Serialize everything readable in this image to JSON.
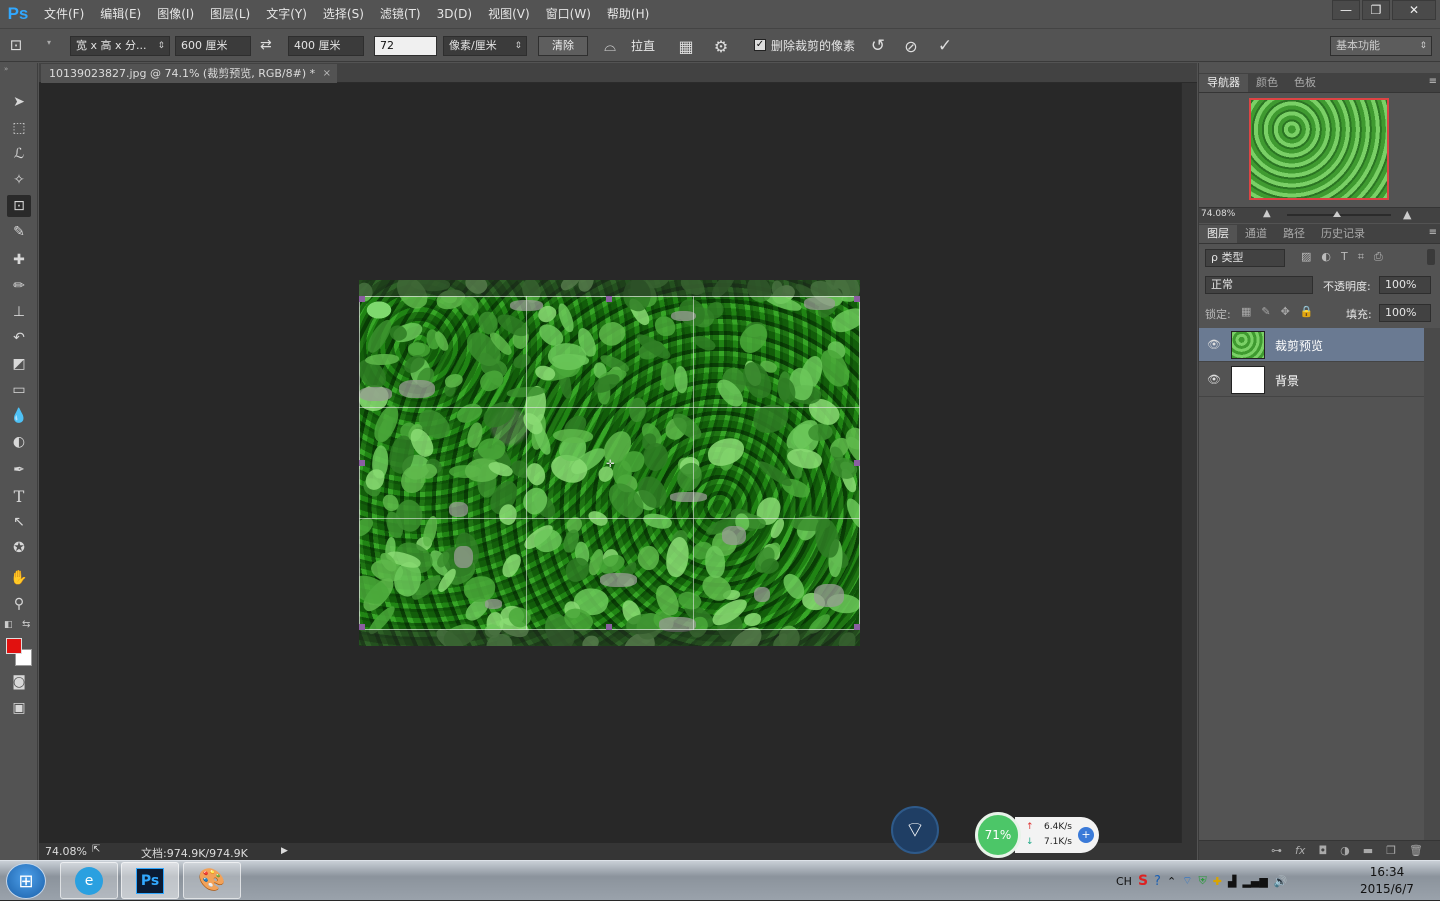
{
  "app": {
    "logo": "Ps",
    "accent": "#31a8ff"
  },
  "menu": [
    "文件(F)",
    "编辑(E)",
    "图像(I)",
    "图层(L)",
    "文字(Y)",
    "选择(S)",
    "滤镜(T)",
    "3D(D)",
    "视图(V)",
    "窗口(W)",
    "帮助(H)"
  ],
  "window_controls": {
    "minimize": "—",
    "restore": "❐",
    "close": "✕"
  },
  "options": {
    "ratio_preset": "宽 x 高 x 分...",
    "width": "600 厘米",
    "height": "400 厘米",
    "resolution": "72",
    "unit": "像素/厘米",
    "clear_button": "清除",
    "straighten_label": "拉直",
    "delete_cropped_label": "删除裁剪的像素",
    "delete_cropped_checked": true,
    "workspace": "基本功能"
  },
  "toolbar_icons": [
    "move-tool-icon",
    "marquee-tool-icon",
    "lasso-tool-icon",
    "magic-wand-tool-icon",
    "crop-tool-icon",
    "eyedropper-tool-icon",
    "healing-brush-tool-icon",
    "brush-tool-icon",
    "clone-stamp-tool-icon",
    "history-brush-tool-icon",
    "eraser-tool-icon",
    "gradient-tool-icon",
    "blur-tool-icon",
    "dodge-tool-icon",
    "pen-tool-icon",
    "type-tool-icon",
    "path-selection-tool-icon",
    "shape-tool-icon",
    "hand-tool-icon",
    "zoom-tool-icon"
  ],
  "colors": {
    "foreground": "#e1110f",
    "background": "#ffffff"
  },
  "document": {
    "tab_title": "10139023827.jpg @ 74.1% (裁剪预览, RGB/8#) *",
    "tab_close": "×",
    "zoom": "74.08%",
    "doc_info": "文档:974.9K/974.9K"
  },
  "navigator": {
    "tabs": [
      "导航器",
      "颜色",
      "色板"
    ],
    "zoom": "74.08%"
  },
  "layers_panel": {
    "tabs": [
      "图层",
      "通道",
      "路径",
      "历史记录"
    ],
    "filter_kind": "ρ 类型",
    "blend_mode": "正常",
    "opacity_label": "不透明度:",
    "opacity": "100%",
    "lock_label": "锁定:",
    "fill_label": "填充:",
    "fill": "100%",
    "layers": [
      {
        "name": "裁剪预览",
        "selected": true
      },
      {
        "name": "背景",
        "selected": false
      }
    ]
  },
  "widgets": {
    "battery_percent": "71%",
    "upload_speed": "6.4K/s",
    "download_speed": "7.1K/s"
  },
  "taskbar": {
    "apps": [
      "ie-browser-icon",
      "photoshop-icon",
      "paint-icon"
    ],
    "ps_label": "Ps",
    "lang": "CH",
    "time": "16:34",
    "date": "2015/6/7"
  }
}
